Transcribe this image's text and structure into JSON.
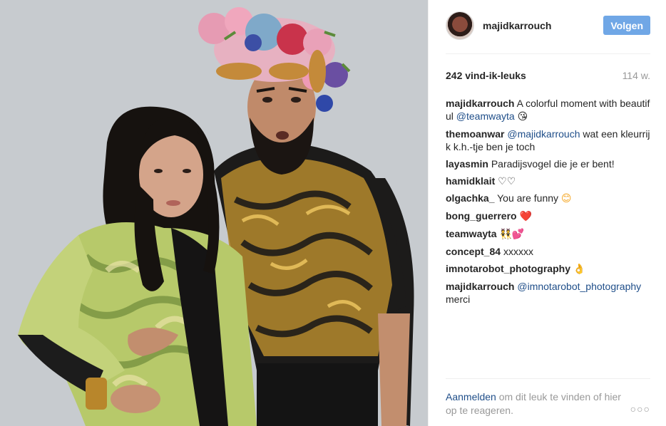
{
  "photo": {
    "alt": ""
  },
  "header": {
    "username": "majidkarrouch",
    "follow_label": "Volgen"
  },
  "meta": {
    "likes": "242 vind-ik-leuks",
    "age": "114 w."
  },
  "comments": [
    {
      "author": "majidkarrouch",
      "pre": "A colorful moment with beautiful ",
      "mention": "@teamwayta",
      "post": "",
      "emoji": "😘"
    },
    {
      "author": "themoanwar",
      "pre": "",
      "mention": "@majidkarrouch",
      "post": " wat een kleurrijk k.h.-tje ben je toch",
      "emoji": ""
    },
    {
      "author": "layasmin",
      "pre": "Paradijsvogel die je er bent!",
      "mention": "",
      "post": "",
      "emoji": ""
    },
    {
      "author": "hamidklait",
      "pre": "♡♡",
      "mention": "",
      "post": "",
      "emoji": ""
    },
    {
      "author": "olgachka_",
      "pre": "You are funny ",
      "mention": "",
      "post": "",
      "emoji": "😊"
    },
    {
      "author": "bong_guerrero",
      "pre": "",
      "mention": "",
      "post": "",
      "emoji": "❤️"
    },
    {
      "author": "teamwayta",
      "pre": "",
      "mention": "",
      "post": "",
      "emoji": "👯💕"
    },
    {
      "author": "concept_84",
      "pre": "xxxxxx",
      "mention": "",
      "post": "",
      "emoji": ""
    },
    {
      "author": "imnotarobot_photography",
      "pre": "",
      "mention": "",
      "post": "",
      "emoji": "👌"
    },
    {
      "author": "majidkarrouch",
      "pre": "",
      "mention": "@imnotarobot_photography",
      "post": " merci",
      "emoji": ""
    }
  ],
  "footer": {
    "login_label": "Aanmelden",
    "rest_text": " om dit leuk te vinden of hier op te reageren.",
    "more_label": "○○○"
  },
  "colors": {
    "follow_button": "#70a7e6",
    "link": "#1f4e89",
    "muted": "#999999"
  }
}
